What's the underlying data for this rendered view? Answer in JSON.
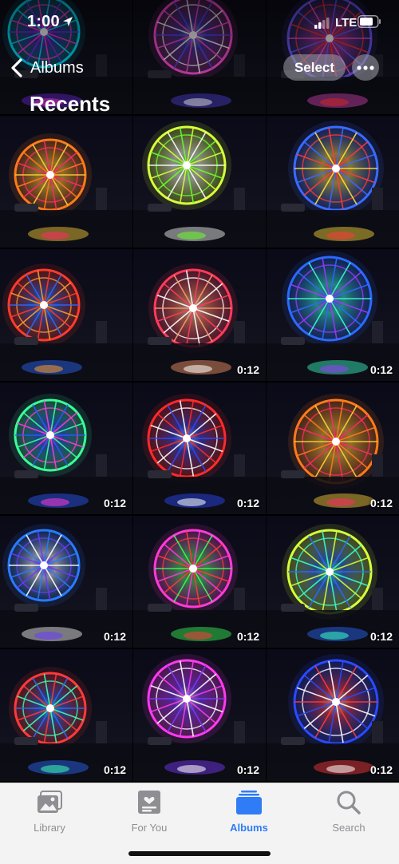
{
  "status_bar": {
    "time": "1:00",
    "network": "LTE"
  },
  "nav": {
    "back_label": "Albums",
    "title": "Recents",
    "select_label": "Select"
  },
  "tabs": [
    {
      "label": "Library",
      "icon": "photo-stack-icon",
      "active": false
    },
    {
      "label": "For You",
      "icon": "for-you-icon",
      "active": false
    },
    {
      "label": "Albums",
      "icon": "albums-icon",
      "active": true
    },
    {
      "label": "Search",
      "icon": "search-icon",
      "active": false
    }
  ],
  "colors": {
    "accent": "#2f7cf6",
    "tab_inactive": "#8e8e93",
    "tab_bg": "#f3f3f3"
  },
  "photos": [
    {
      "duration": "",
      "palette": [
        "#00e5ff",
        "#7b2cff",
        "#ff3bd8"
      ]
    },
    {
      "duration": "",
      "palette": [
        "#ff4fd8",
        "#5a4bff",
        "#ffffff"
      ]
    },
    {
      "duration": "",
      "palette": [
        "#6a5bff",
        "#ff4fd8",
        "#ff3030"
      ]
    },
    {
      "duration": "",
      "palette": [
        "#ff7a1a",
        "#ffd23a",
        "#ff2a6a"
      ]
    },
    {
      "duration": "",
      "palette": [
        "#d6ff3a",
        "#ffffff",
        "#6aff2a"
      ]
    },
    {
      "duration": "",
      "palette": [
        "#3a6aff",
        "#ffe03a",
        "#ff3a3a"
      ]
    },
    {
      "duration": "",
      "palette": [
        "#ff3a2a",
        "#2a6aff",
        "#ff9a2a"
      ]
    },
    {
      "duration": "0:12",
      "palette": [
        "#ff3a5a",
        "#ff9a6a",
        "#ffffff"
      ]
    },
    {
      "duration": "0:12",
      "palette": [
        "#2a6aff",
        "#3affc8",
        "#9a3aff"
      ]
    },
    {
      "duration": "0:12",
      "palette": [
        "#3aff9a",
        "#2a5aff",
        "#ff3ad8"
      ]
    },
    {
      "duration": "0:12",
      "palette": [
        "#ff2a2a",
        "#2a4aff",
        "#ffffff"
      ]
    },
    {
      "duration": "0:12",
      "palette": [
        "#ff7a1a",
        "#ffd23a",
        "#ff2a6a"
      ]
    },
    {
      "duration": "0:12",
      "palette": [
        "#2a7aff",
        "#ffffff",
        "#6a3aff"
      ]
    },
    {
      "duration": "0:12",
      "palette": [
        "#ff3ad8",
        "#3aff5a",
        "#ff3a3a"
      ]
    },
    {
      "duration": "0:12",
      "palette": [
        "#d6ff3a",
        "#2a6aff",
        "#3affc8"
      ]
    },
    {
      "duration": "0:12",
      "palette": [
        "#ff3a3a",
        "#2a6aff",
        "#3affb0"
      ]
    },
    {
      "duration": "0:12",
      "palette": [
        "#ff3af0",
        "#7a3aff",
        "#ffffff"
      ]
    },
    {
      "duration": "0:12",
      "palette": [
        "#2a4aff",
        "#ff3a3a",
        "#ffffff"
      ]
    }
  ]
}
